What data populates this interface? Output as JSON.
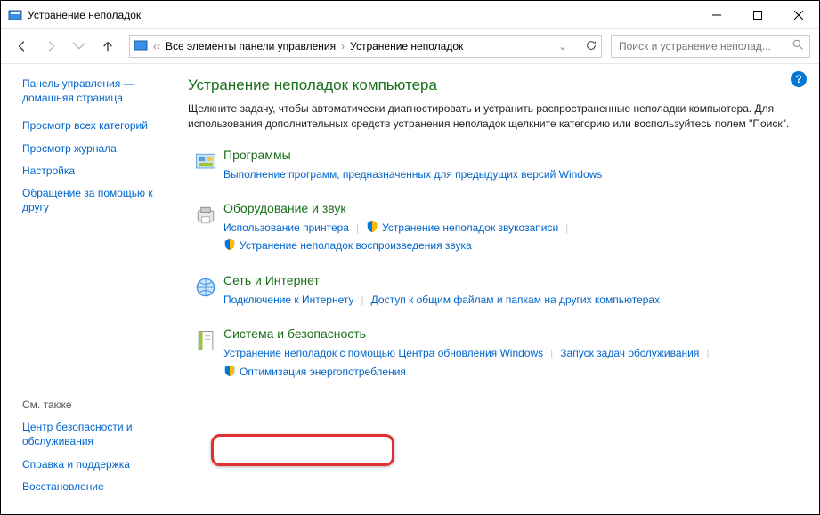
{
  "window": {
    "title": "Устранение неполадок"
  },
  "nav": {
    "root": "Все элементы панели управления",
    "current": "Устранение неполадок",
    "search_placeholder": "Поиск и устранение неполад..."
  },
  "sidebar": {
    "top": [
      "Панель управления — домашняя страница",
      "Просмотр всех категорий",
      "Просмотр журнала",
      "Настройка",
      "Обращение за помощью к другу"
    ],
    "see_also_heading": "См. также",
    "bottom": [
      "Центр безопасности и обслуживания",
      "Справка и поддержка",
      "Восстановление"
    ]
  },
  "main": {
    "title": "Устранение неполадок компьютера",
    "desc": "Щелкните задачу, чтобы автоматически диагностировать и устранить распространенные неполадки компьютера. Для использования дополнительных средств устранения неполадок щелкните категорию или воспользуйтесь полем \"Поиск\".",
    "categories": [
      {
        "title": "Программы",
        "links": [
          {
            "text": "Выполнение программ, предназначенных для предыдущих версий Windows",
            "shield": false
          }
        ]
      },
      {
        "title": "Оборудование и звук",
        "links": [
          {
            "text": "Использование принтера",
            "shield": false
          },
          {
            "text": "Устранение неполадок звукозаписи",
            "shield": true
          },
          {
            "text": "Устранение неполадок воспроизведения звука",
            "shield": true
          }
        ]
      },
      {
        "title": "Сеть и Интернет",
        "links": [
          {
            "text": "Подключение к Интернету",
            "shield": false
          },
          {
            "text": "Доступ к общим файлам и папкам на других компьютерах",
            "shield": false
          }
        ]
      },
      {
        "title": "Система и безопасность",
        "links": [
          {
            "text": "Устранение неполадок с помощью Центра обновления Windows",
            "shield": false
          },
          {
            "text": "Запуск задач обслуживания",
            "shield": false
          },
          {
            "text": "Оптимизация энергопотребления",
            "shield": true
          }
        ]
      }
    ]
  }
}
